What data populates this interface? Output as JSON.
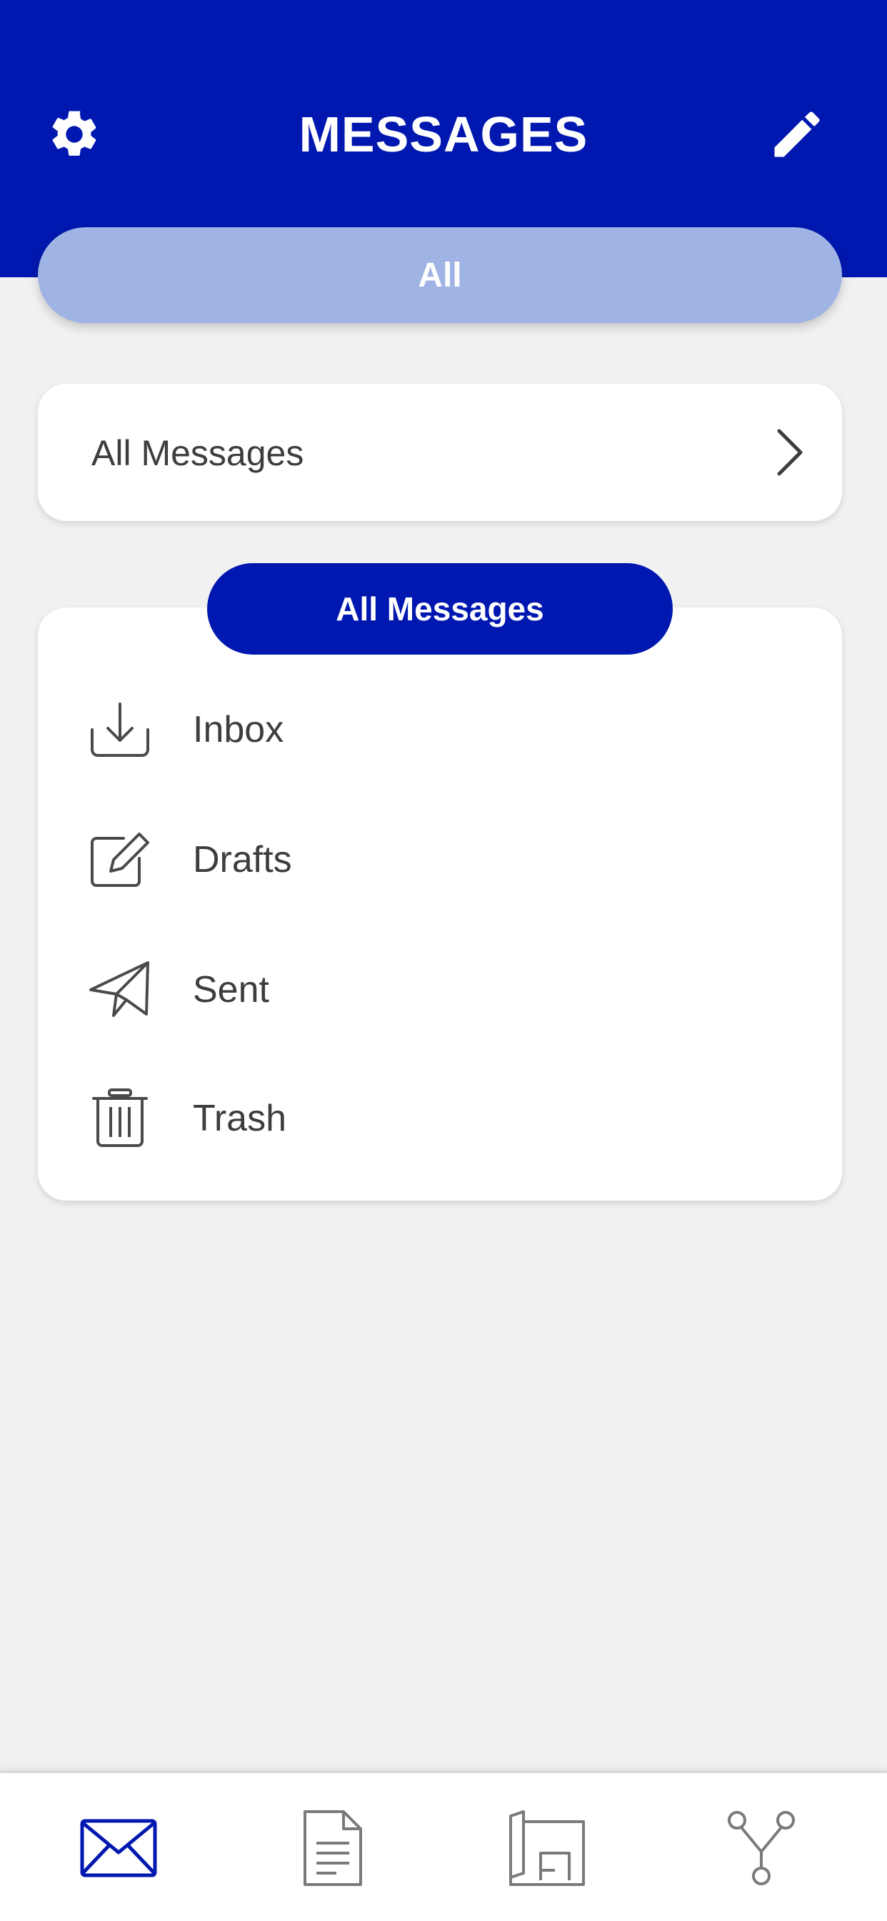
{
  "header": {
    "title": "MESSAGES",
    "settings_icon": "gear-icon",
    "compose_icon": "pencil-icon"
  },
  "segment": {
    "selected": "All"
  },
  "selector": {
    "label": "All Messages",
    "icon": "chevron-right-icon"
  },
  "folders": {
    "section_title": "All Messages",
    "items": [
      {
        "label": "Inbox",
        "icon": "inbox-download-icon"
      },
      {
        "label": "Drafts",
        "icon": "edit-square-icon"
      },
      {
        "label": "Sent",
        "icon": "paper-plane-icon"
      },
      {
        "label": "Trash",
        "icon": "trash-icon"
      }
    ]
  },
  "tabbar": {
    "tabs": [
      {
        "icon": "envelope-icon",
        "active": true
      },
      {
        "icon": "document-icon",
        "active": false
      },
      {
        "icon": "floor-plan-icon",
        "active": false
      },
      {
        "icon": "branch-icon",
        "active": false
      }
    ]
  },
  "colors": {
    "brand": "#0018b0",
    "segment_bg": "#9fb3e4",
    "background": "#f1f1f1",
    "text": "#3d3d3d",
    "icon_inactive": "#7a7a7a"
  }
}
